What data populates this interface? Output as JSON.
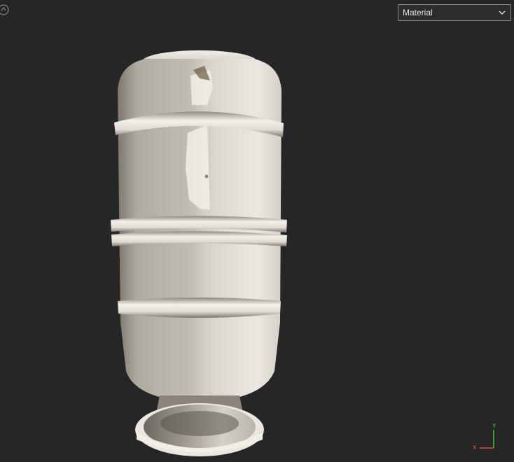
{
  "toolbar": {
    "view_mode": "Material"
  },
  "axis_gizmo": {
    "x_label": "X",
    "y_label": "Y",
    "x_color": "#d9534f",
    "y_color": "#4cbf3f"
  },
  "icons": {
    "nav": "orbit-camera-icon",
    "dropdown": "chevron-down-icon"
  },
  "colors": {
    "background": "#262626",
    "model": "#e2ded6"
  }
}
